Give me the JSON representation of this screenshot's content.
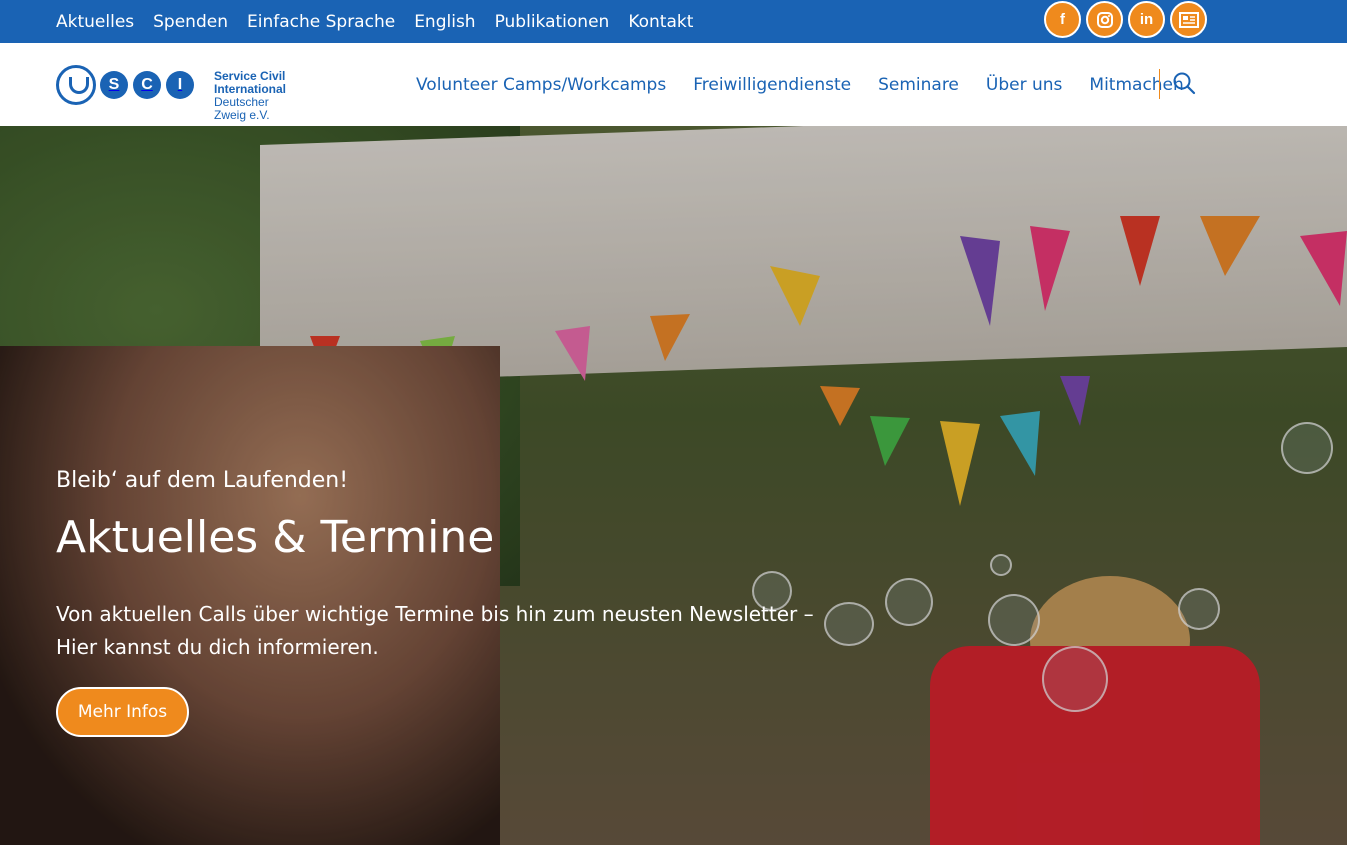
{
  "topbar": {
    "links": [
      "Aktuelles",
      "Spenden",
      "Einfache Sprache",
      "English",
      "Publikationen",
      "Kontakt"
    ],
    "social": [
      {
        "name": "facebook-icon",
        "glyph": "f"
      },
      {
        "name": "instagram-icon",
        "glyph": ""
      },
      {
        "name": "linkedin-icon",
        "glyph": "in"
      },
      {
        "name": "newsletter-icon",
        "glyph": ""
      }
    ]
  },
  "header": {
    "logo_letters": [
      "S",
      "C",
      "I"
    ],
    "logo_line1": "Service Civil International",
    "logo_line2": "Deutscher Zweig e.V.",
    "nav": [
      "Volunteer Camps/Workcamps",
      "Freiwilligendienste",
      "Seminare",
      "Über uns",
      "Mitmachen"
    ]
  },
  "hero": {
    "kicker": "Bleib‘ auf dem Laufenden!",
    "title": "Aktuelles & Termine",
    "description": "Von aktuellen Calls über wichtige Termine bis hin zum neusten Newsletter – Hier kannst du dich informieren.",
    "cta_label": "Mehr Infos"
  },
  "colors": {
    "primary": "#1a63b4",
    "accent": "#ef8a1d"
  }
}
